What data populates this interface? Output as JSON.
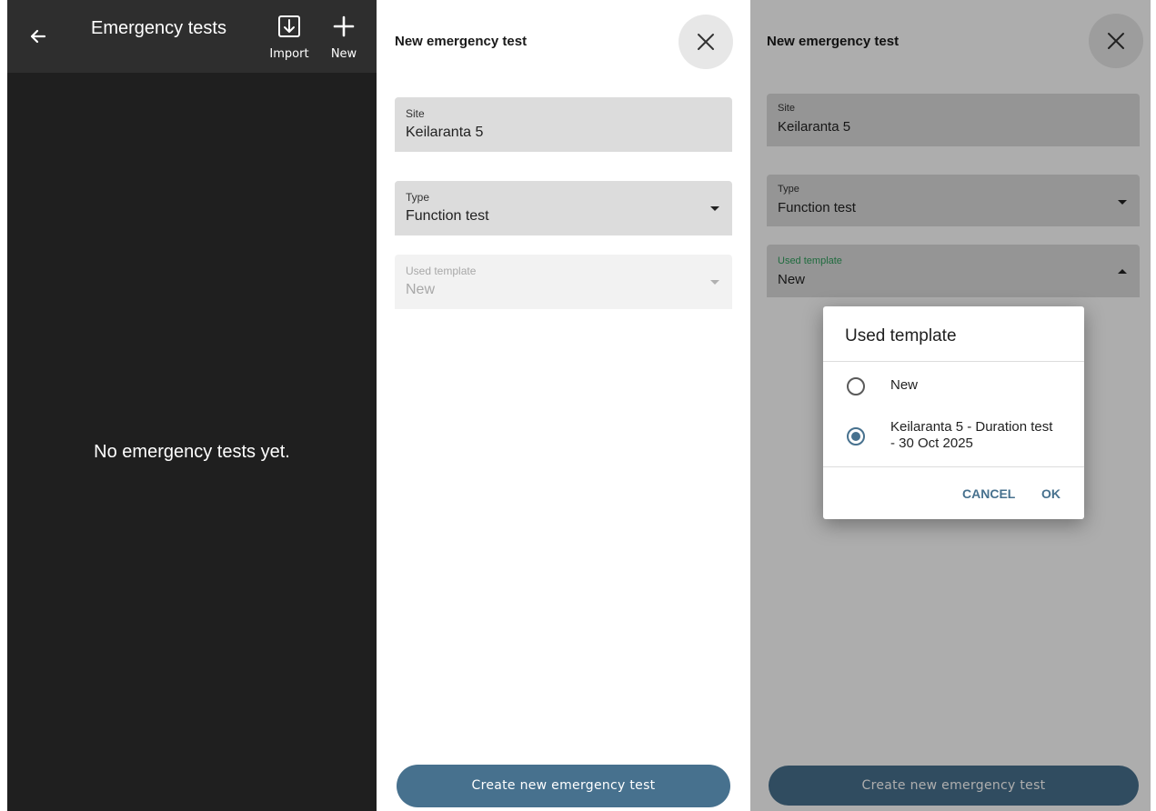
{
  "list_screen": {
    "title": "Emergency tests",
    "import_label": "Import",
    "new_label": "New",
    "empty_message": "No emergency tests yet."
  },
  "form_screen": {
    "title": "New emergency test",
    "site": {
      "label": "Site",
      "value": "Keilaranta 5"
    },
    "type": {
      "label": "Type",
      "value": "Function test"
    },
    "template": {
      "label": "Used template",
      "value": "New"
    },
    "create_button": "Create new emergency test"
  },
  "template_dialog_screen": {
    "title": "New emergency test",
    "site": {
      "label": "Site",
      "value": "Keilaranta 5"
    },
    "type": {
      "label": "Type",
      "value": "Function test"
    },
    "template": {
      "label": "Used template",
      "value": "New"
    },
    "create_button": "Create new emergency test",
    "dialog": {
      "title": "Used template",
      "options": [
        {
          "label": "New",
          "selected": false
        },
        {
          "label": "Keilaranta 5 - Duration test - 30 Oct 2025",
          "selected": true
        }
      ],
      "cancel_label": "CANCEL",
      "ok_label": "OK"
    }
  },
  "colors": {
    "primary": "#47718e",
    "dark_bg": "#1f1f1f",
    "appbar": "#2e2e2e",
    "field_bg": "#dcdcdc",
    "active_label": "#2f9e5c"
  }
}
